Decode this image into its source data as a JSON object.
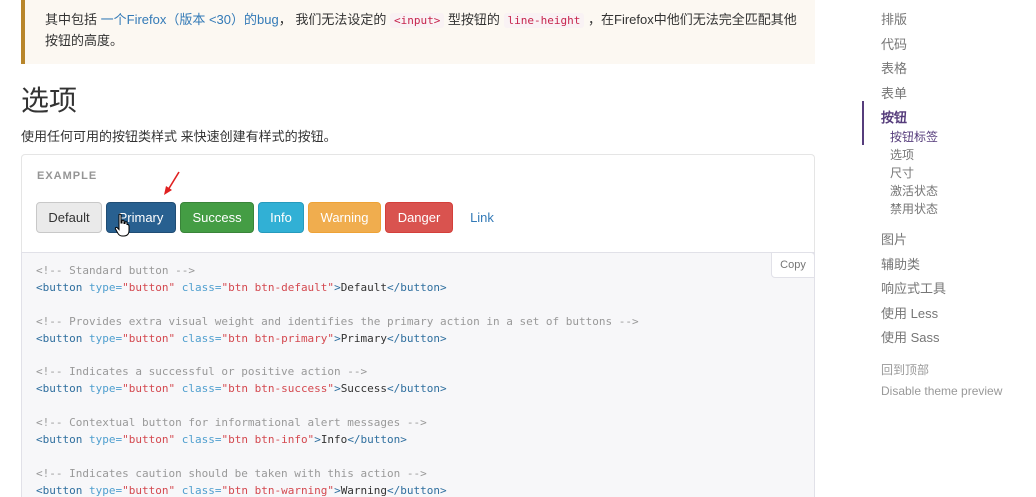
{
  "callout": {
    "text_prefix": "其中包括 ",
    "link_text": "一个Firefox（版本 <30）的bug",
    "text_mid": "， 我们无法设定的 ",
    "code1": "<input>",
    "text_mid2": " 型按钮的 ",
    "code2": "line-height",
    "text_suffix": " ，在Firefox中他们无法完全匹配其他按钮的高度。"
  },
  "section": {
    "title": "选项",
    "lead": "使用任何可用的按钮类样式 来快速创建有样式的按钮。"
  },
  "example": {
    "label": "EXAMPLE",
    "buttons": {
      "default": "Default",
      "primary": "Primary",
      "success": "Success",
      "info": "Info",
      "warning": "Warning",
      "danger": "Danger",
      "link": "Link"
    }
  },
  "code": {
    "copy_label": "Copy",
    "lines": [
      {
        "comment": "<!-- Standard button -->",
        "cls": "btn btn-default",
        "text": "Default"
      },
      {
        "comment": "<!-- Provides extra visual weight and identifies the primary action in a set of buttons -->",
        "cls": "btn btn-primary",
        "text": "Primary"
      },
      {
        "comment": "<!-- Indicates a successful or positive action -->",
        "cls": "btn btn-success",
        "text": "Success"
      },
      {
        "comment": "<!-- Contextual button for informational alert messages -->",
        "cls": "btn btn-info",
        "text": "Info"
      },
      {
        "comment": "<!-- Indicates caution should be taken with this action -->",
        "cls": "btn btn-warning",
        "text": "Warning"
      }
    ],
    "tag_open": "<button",
    "attr_type": "type=",
    "val_type": "\"button\"",
    "attr_class": "class=",
    "tag_close": "</button>"
  },
  "sidebar": {
    "items": [
      "排版",
      "代码",
      "表格",
      "表单",
      "按钮"
    ],
    "sub_items": [
      "按钮标签",
      "选项",
      "尺寸",
      "激活状态",
      "禁用状态"
    ],
    "items_after": [
      "图片",
      "辅助类",
      "响应式工具",
      "使用 Less",
      "使用 Sass"
    ],
    "back_to_top": "回到顶部",
    "disable_preview": "Disable theme preview"
  },
  "colors": {
    "primary": "#286090",
    "success": "#449d44",
    "info": "#31b0d5",
    "warning": "#f0ad4e",
    "danger": "#d9534f",
    "link": "#337ab7",
    "nav_active": "#563d7c"
  },
  "icons": [
    "red-arrow-annotation-icon",
    "hand-cursor-icon"
  ]
}
